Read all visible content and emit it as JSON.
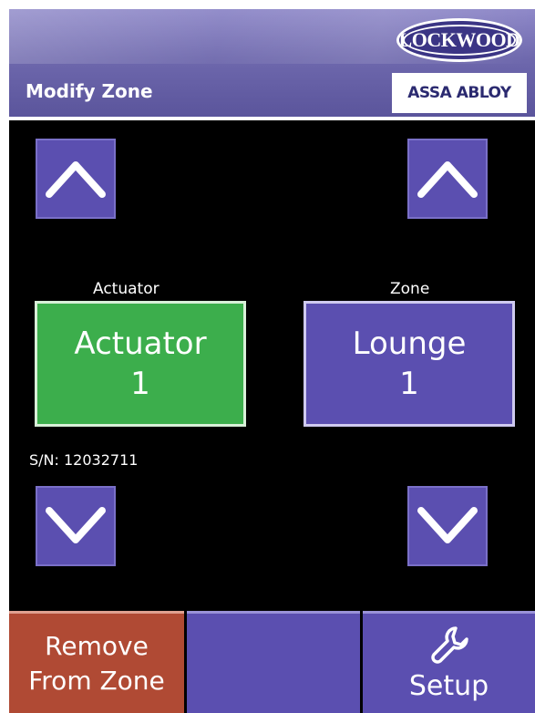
{
  "header": {
    "title": "Modify Zone",
    "logo_text": "LOCKWOOD",
    "logo_sub": "ASSA ABLOY"
  },
  "actuator": {
    "label": "Actuator",
    "value_line1": "Actuator",
    "value_line2": "1",
    "serial": "S/N: 12032711"
  },
  "zone": {
    "label": "Zone",
    "value_line1": "Lounge",
    "value_line2": "1"
  },
  "bottom": {
    "remove_line1": "Remove",
    "remove_line2": "From Zone",
    "setup_label": "Setup"
  },
  "icons": {
    "up": "chevron-up-icon",
    "down": "chevron-down-icon",
    "setup": "wrench-icon"
  },
  "colors": {
    "header": "#6e68ad",
    "button_purple": "#5b4fb0",
    "actuator_green": "#3cae4c",
    "remove_red": "#b04a34",
    "background": "#000000"
  }
}
